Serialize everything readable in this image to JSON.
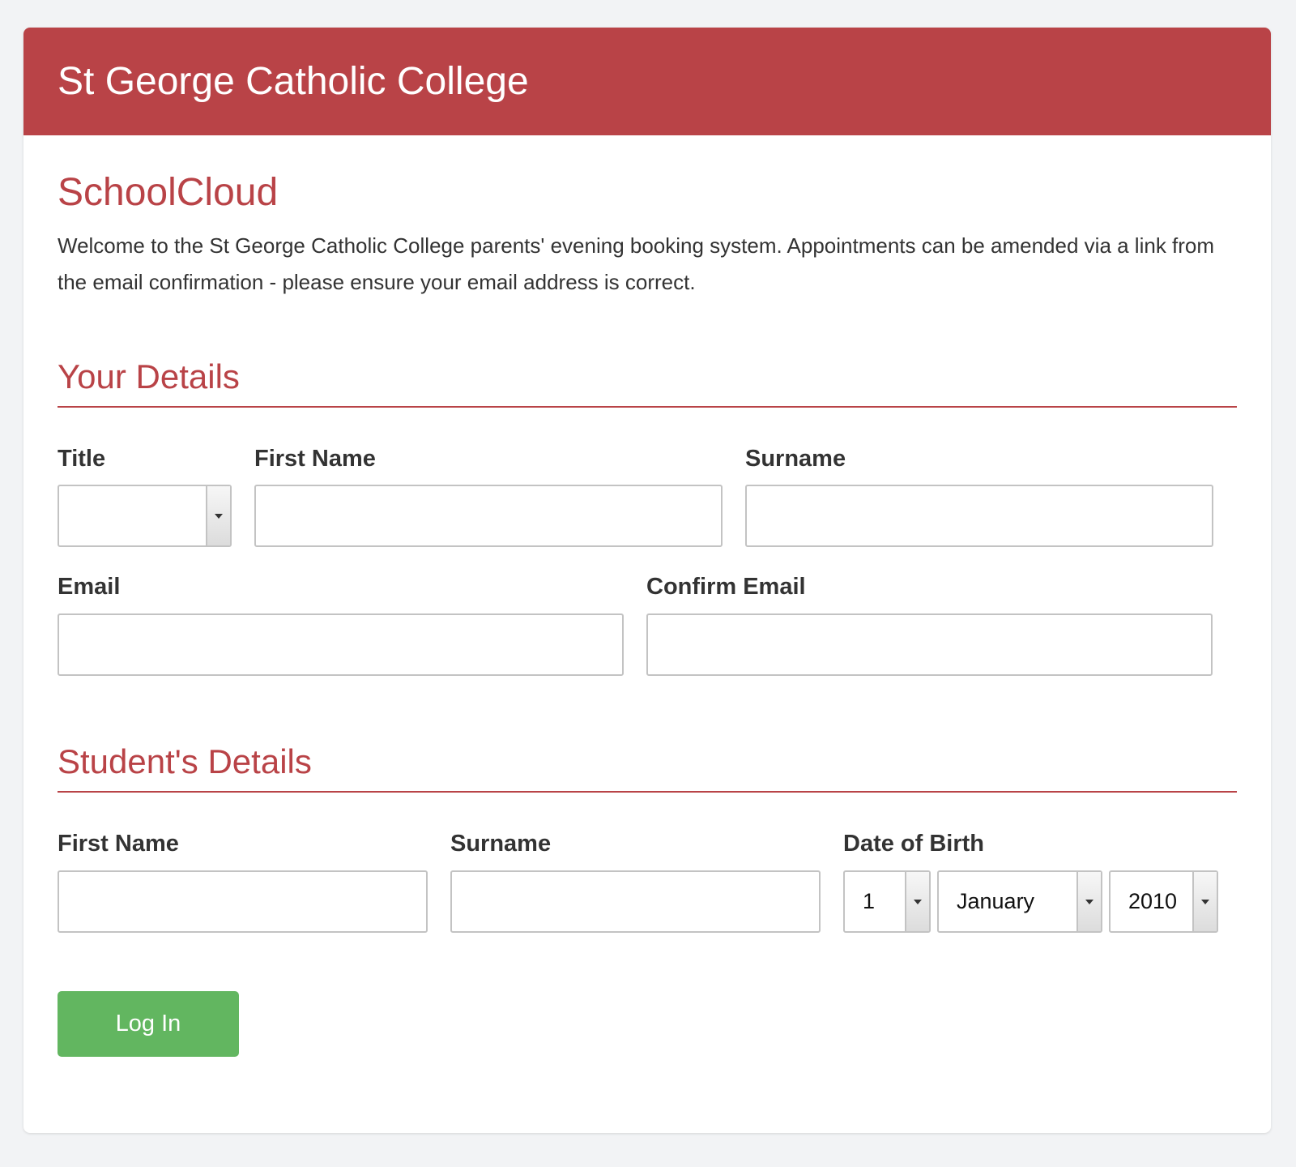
{
  "header": {
    "school_name": "St George Catholic College"
  },
  "intro": {
    "brand": "SchoolCloud",
    "welcome_text": "Welcome to the St George Catholic College parents' evening booking system. Appointments can be amended via a link from the email confirmation - please ensure your email address is correct."
  },
  "your_details": {
    "heading": "Your Details",
    "title_label": "Title",
    "title_value": "",
    "first_name_label": "First Name",
    "first_name_value": "",
    "surname_label": "Surname",
    "surname_value": "",
    "email_label": "Email",
    "email_value": "",
    "confirm_email_label": "Confirm Email",
    "confirm_email_value": ""
  },
  "student_details": {
    "heading": "Student's Details",
    "first_name_label": "First Name",
    "first_name_value": "",
    "surname_label": "Surname",
    "surname_value": "",
    "dob_label": "Date of Birth",
    "dob_day": "1",
    "dob_month": "January",
    "dob_year": "2010"
  },
  "actions": {
    "login_label": "Log In"
  },
  "colors": {
    "brand_red": "#b94347",
    "login_green": "#62b660",
    "page_background": "#f2f3f5"
  },
  "icons": {
    "select_arrow": "chevron-down-icon"
  }
}
